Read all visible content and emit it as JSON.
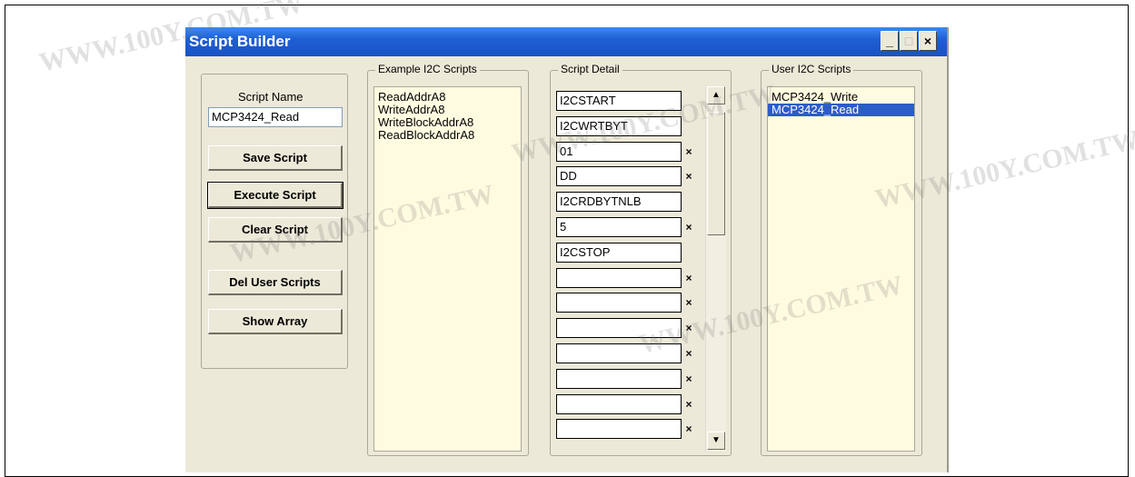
{
  "window": {
    "title": "Script Builder",
    "minimize": "_",
    "maximize": "□",
    "close": "×"
  },
  "left_panel": {
    "script_name_label": "Script Name",
    "script_name_value": "MCP3424_Read",
    "buttons": {
      "save": "Save Script",
      "execute": "Execute Script",
      "clear": "Clear Script",
      "del_user": "Del User Scripts",
      "show_array": "Show Array"
    }
  },
  "example_scripts": {
    "title": "Example I2C Scripts",
    "items": [
      "ReadAddrA8",
      "WriteAddrA8",
      "WriteBlockAddrA8",
      "ReadBlockAddrA8"
    ]
  },
  "script_detail": {
    "title": "Script Detail",
    "rows": [
      {
        "value": "I2CSTART",
        "x": ""
      },
      {
        "value": "I2CWRTBYT",
        "x": ""
      },
      {
        "value": "01",
        "x": "×"
      },
      {
        "value": "DD",
        "x": "×"
      },
      {
        "value": "I2CRDBYTNLB",
        "x": ""
      },
      {
        "value": "5",
        "x": "×"
      },
      {
        "value": "I2CSTOP",
        "x": ""
      },
      {
        "value": "",
        "x": "×"
      },
      {
        "value": "",
        "x": "×"
      },
      {
        "value": "",
        "x": "×"
      },
      {
        "value": "",
        "x": "×"
      },
      {
        "value": "",
        "x": "×"
      },
      {
        "value": "",
        "x": "×"
      },
      {
        "value": "",
        "x": "×"
      }
    ],
    "scroll_up": "▲",
    "scroll_down": "▼"
  },
  "user_scripts": {
    "title": "User I2C Scripts",
    "items": [
      "MCP3424_Write",
      "MCP3424_Read"
    ],
    "selected": "MCP3424_Read"
  },
  "watermark_text": "WWW.100Y.COM.TW",
  "colors": {
    "title_bar": "#1f5fd4",
    "selection": "#2c5cc8",
    "list_bg": "#fffbe0"
  }
}
